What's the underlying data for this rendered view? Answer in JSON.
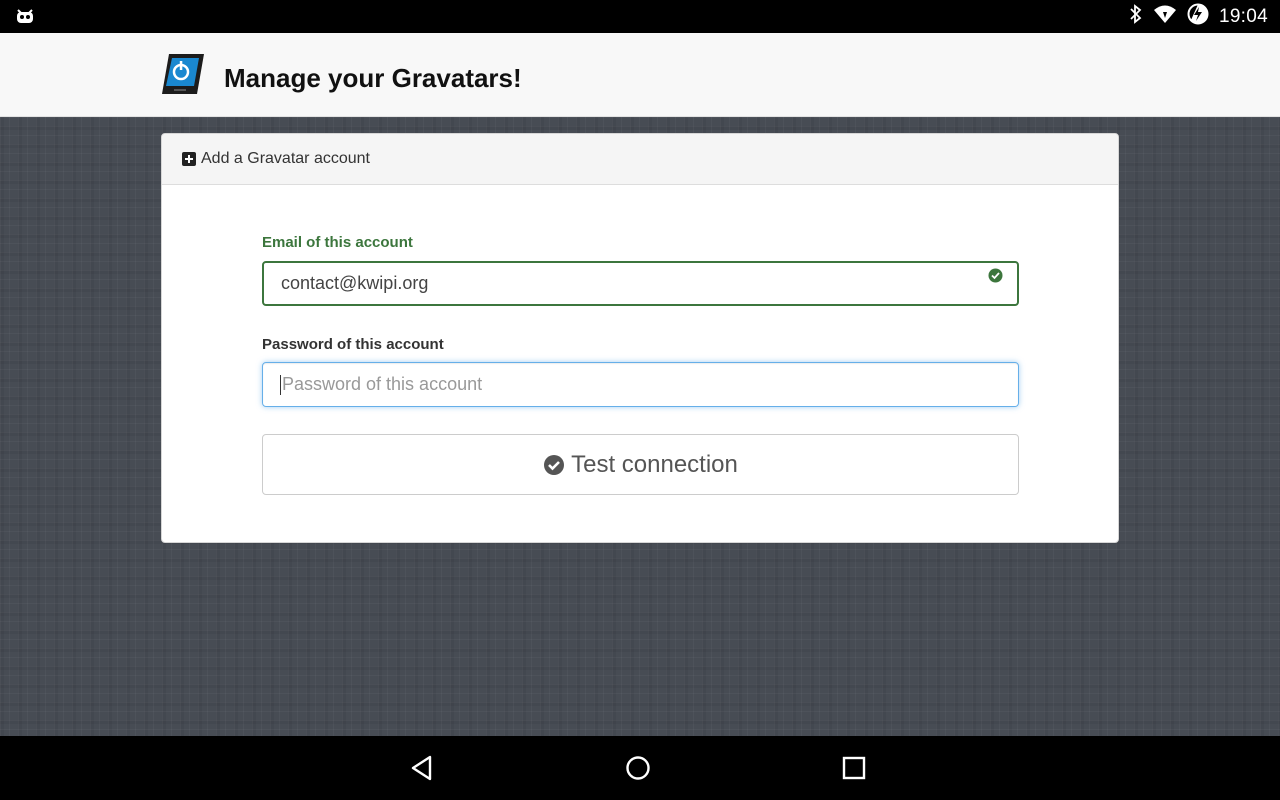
{
  "status_bar": {
    "time": "19:04",
    "icons": [
      "android-debug-icon",
      "bluetooth-icon",
      "wifi-icon",
      "battery-charging-icon"
    ]
  },
  "header": {
    "title": "Manage your Gravatars!",
    "logo_icon": "gravatar-app-logo"
  },
  "panel": {
    "heading": "Add a Gravatar account",
    "heading_icon": "plus-square-icon",
    "email": {
      "label": "Email of this account",
      "value": "contact@kwipi.org",
      "state": "valid",
      "state_icon": "check-circle-icon"
    },
    "password": {
      "label": "Password of this account",
      "placeholder": "Password of this account",
      "value": "",
      "focused": true
    },
    "test_button": {
      "label": "Test connection",
      "icon": "check-circle-icon"
    }
  },
  "nav_bar": {
    "buttons": [
      "back-icon",
      "home-icon",
      "recents-icon"
    ]
  },
  "colors": {
    "success": "#3c763d",
    "focus": "#66afe9",
    "logo_blue": "#1a88d0"
  }
}
